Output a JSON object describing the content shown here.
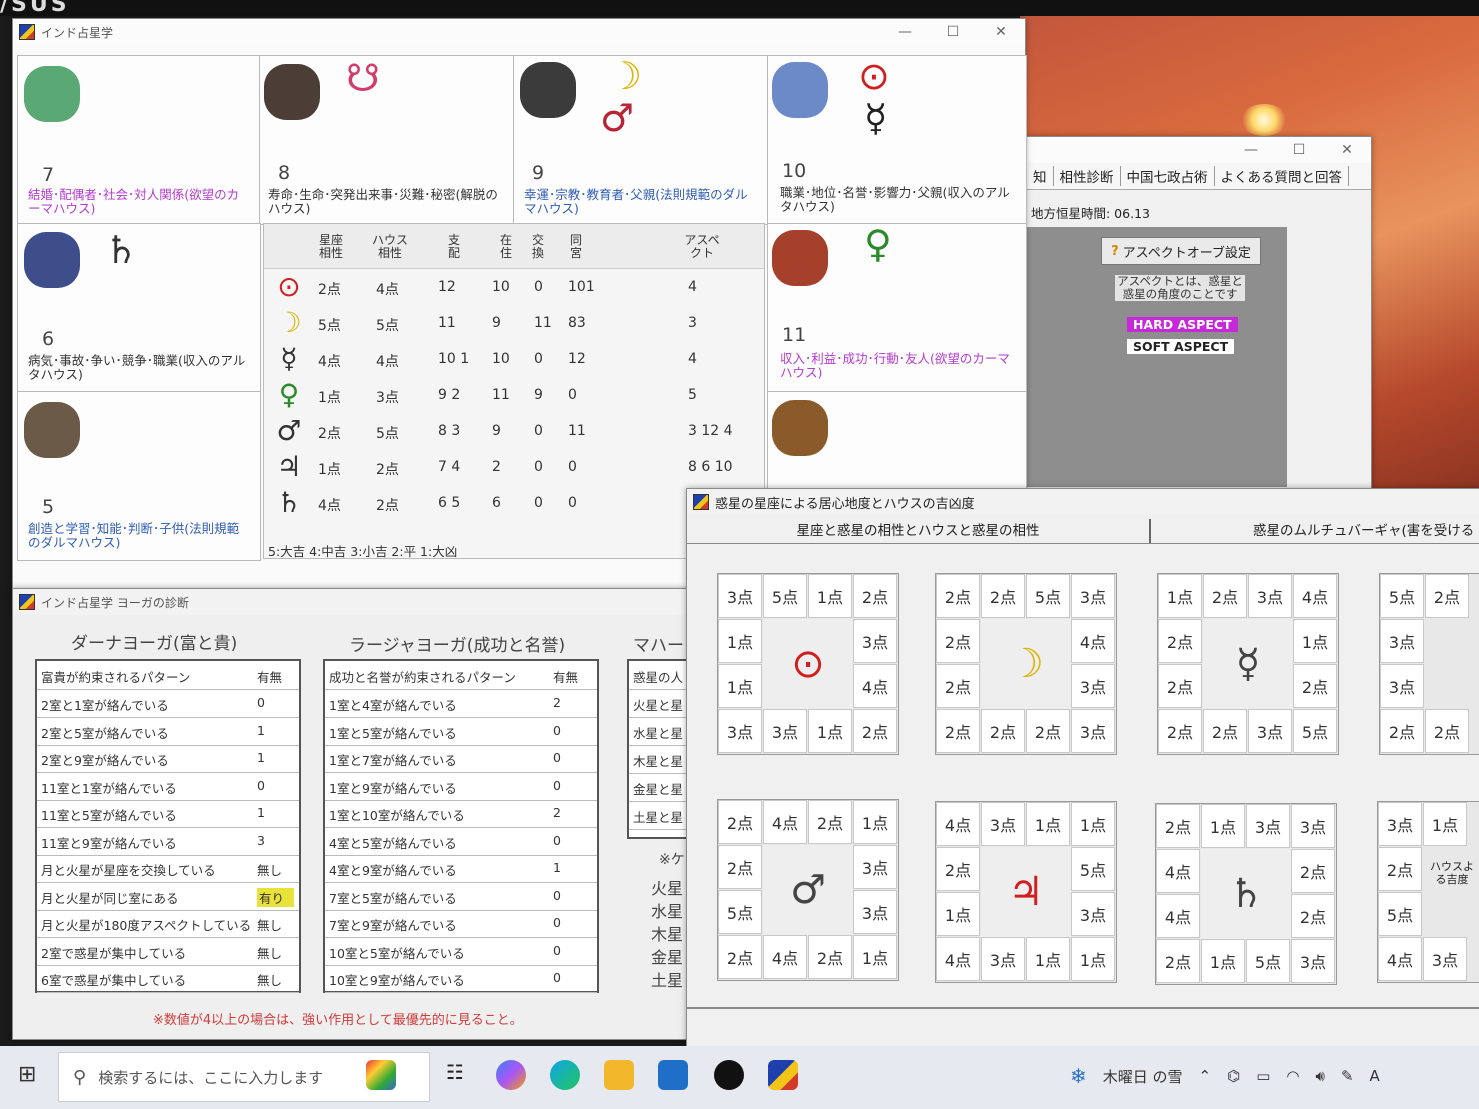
{
  "brand": "/SUS",
  "window_chart": {
    "title": "インド占星学",
    "houses": [
      {
        "num": "7",
        "desc": "結婚･配偶者･社会･対人関係(欲望のカーマハウス)"
      },
      {
        "num": "8",
        "desc": "寿命･生命･突発出来事･災難･秘密(解脱のハウス)"
      },
      {
        "num": "9",
        "desc": "幸運･宗教･教育者･父親(法則規範のダルマハウス)"
      },
      {
        "num": "10",
        "desc": "職業･地位･名誉･影響力･父親(収入のアルタハウス)"
      },
      {
        "num": "6",
        "desc": "病気･事故･争い･競争･職業(収入のアルタハウス)"
      },
      {
        "num": "11",
        "desc": "収入･利益･成功･行動･友人(欲望のカーマハウス)"
      },
      {
        "num": "5",
        "desc": "創造と学習･知能･判断･子供(法則規範のダルマハウス)"
      }
    ],
    "table_headers": [
      "星座相性",
      "ハウス相性",
      "支配",
      "在住",
      "交換",
      "同宮",
      "アスペクト"
    ],
    "rows": [
      {
        "sym": "⊙",
        "a": "2点",
        "b": "4点",
        "c": "12",
        "d": "10",
        "e": "0",
        "f": "101",
        "g": "4"
      },
      {
        "sym": "☽",
        "a": "5点",
        "b": "5点",
        "c": "11",
        "d": "9",
        "e": "11",
        "f": "83",
        "g": "3"
      },
      {
        "sym": "☿",
        "a": "4点",
        "b": "4点",
        "c": "10 1",
        "d": "10",
        "e": "0",
        "f": "12",
        "g": "4"
      },
      {
        "sym": "♀",
        "a": "1点",
        "b": "3点",
        "c": "9 2",
        "d": "11",
        "e": "9",
        "f": "0",
        "g": "5"
      },
      {
        "sym": "♂",
        "a": "2点",
        "b": "5点",
        "c": "8 3",
        "d": "9",
        "e": "0",
        "f": "11",
        "g": "3 12 4"
      },
      {
        "sym": "♃",
        "a": "1点",
        "b": "2点",
        "c": "7 4",
        "d": "2",
        "e": "0",
        "f": "0",
        "g": "8 6 10"
      },
      {
        "sym": "♄",
        "a": "4点",
        "b": "2点",
        "c": "6 5",
        "d": "6",
        "e": "0",
        "f": "0",
        "g": ""
      }
    ],
    "legend": "5:大吉 4:中吉 3:小吉 2:平 1:大凶"
  },
  "window_right": {
    "menu": [
      "知",
      "相性診断",
      "中国七政占術",
      "よくある質問と回答"
    ],
    "local_time": "地方恒星時間: 06.13",
    "aspect_button": "アスペクトオーブ設定",
    "aspect_note": "アスペクトとは、惑星と惑星の角度のことです",
    "hard": "HARD ASPECT",
    "soft": "SOFT ASPECT"
  },
  "window_yoga": {
    "title": "インド占星学 ヨーガの診断",
    "dhana_title": "ダーナヨーガ(富と貴)",
    "dhana_header": [
      "富貴が約束されるパターン",
      "有無"
    ],
    "dhana_rows": [
      {
        "p": "2室と1室が絡んでいる",
        "v": "0"
      },
      {
        "p": "2室と5室が絡んでいる",
        "v": "1"
      },
      {
        "p": "2室と9室が絡んでいる",
        "v": "1"
      },
      {
        "p": "11室と1室が絡んでいる",
        "v": "0"
      },
      {
        "p": "11室と5室が絡んでいる",
        "v": "1"
      },
      {
        "p": "11室と9室が絡んでいる",
        "v": "3"
      },
      {
        "p": "月と火星が星座を交換している",
        "v": "無し"
      },
      {
        "p": "月と火星が同じ室にある",
        "v": "有り"
      },
      {
        "p": "月と火星が180度アスペクトしている",
        "v": "無し"
      },
      {
        "p": "2室で惑星が集中している",
        "v": "無し"
      },
      {
        "p": "6室で惑星が集中している",
        "v": "無し"
      }
    ],
    "raja_title": "ラージャヨーガ(成功と名誉)",
    "raja_header": [
      "成功と名誉が約束されるパターン",
      "有無"
    ],
    "raja_rows": [
      {
        "p": "1室と4室が絡んでいる",
        "v": "2"
      },
      {
        "p": "1室と5室が絡んでいる",
        "v": "0"
      },
      {
        "p": "1室と7室が絡んでいる",
        "v": "0"
      },
      {
        "p": "1室と9室が絡んでいる",
        "v": "0"
      },
      {
        "p": "1室と10室が絡んでいる",
        "v": "2"
      },
      {
        "p": "4室と5室が絡んでいる",
        "v": "0"
      },
      {
        "p": "4室と9室が絡んでいる",
        "v": "1"
      },
      {
        "p": "7室と5室が絡んでいる",
        "v": "0"
      },
      {
        "p": "7室と9室が絡んでいる",
        "v": "0"
      },
      {
        "p": "10室と5室が絡んでいる",
        "v": "0"
      },
      {
        "p": "10室と9室が絡んでいる",
        "v": "0"
      }
    ],
    "maha_title": "マハー",
    "maha_rows": [
      "惑星の人",
      "火星と星",
      "水星と星",
      "木星と星",
      "金星と星",
      "土星と星"
    ],
    "maha_note": "※ケ",
    "maha_list": [
      "火星",
      "水星",
      "木星",
      "金星",
      "土星"
    ],
    "footer_note": "※数値が4以上の場合は、強い作用として最優先的に見ること。"
  },
  "window_dignity": {
    "title": "惑星の星座による居心地度とハウスの吉凶度",
    "tab1": "星座と惑星の相性とハウスと惑星の相性",
    "tab2": "惑星のムルチュバーギャ(害を受ける",
    "grids": [
      {
        "sym": "⊙",
        "color": "#d11f1f",
        "top": [
          "3点",
          "5点",
          "1点",
          "2点"
        ],
        "left": [
          "1点",
          "1点"
        ],
        "right": [
          "3点",
          "4点"
        ],
        "bottom": [
          "3点",
          "3点",
          "1点",
          "2点"
        ]
      },
      {
        "sym": "☽",
        "color": "#d9b400",
        "top": [
          "2点",
          "2点",
          "5点",
          "3点"
        ],
        "left": [
          "2点",
          "2点"
        ],
        "right": [
          "4点",
          "3点"
        ],
        "bottom": [
          "2点",
          "2点",
          "2点",
          "3点"
        ]
      },
      {
        "sym": "☿",
        "color": "#444",
        "top": [
          "1点",
          "2点",
          "3点",
          "4点"
        ],
        "left": [
          "2点",
          "2点"
        ],
        "right": [
          "1点",
          "2点"
        ],
        "bottom": [
          "2点",
          "2点",
          "3点",
          "5点"
        ]
      },
      {
        "sym": "♂",
        "color": "#444",
        "top": [
          "2点",
          "4点",
          "2点",
          "1点"
        ],
        "left": [
          "2点",
          "5点"
        ],
        "right": [
          "3点",
          "3点"
        ],
        "bottom": [
          "2点",
          "4点",
          "2点",
          "1点"
        ]
      },
      {
        "sym": "♃",
        "color": "#d11f1f",
        "top": [
          "4点",
          "3点",
          "1点",
          "1点"
        ],
        "left": [
          "2点",
          "1点"
        ],
        "right": [
          "5点",
          "3点"
        ],
        "bottom": [
          "4点",
          "3点",
          "1点",
          "1点"
        ]
      },
      {
        "sym": "♄",
        "color": "#444",
        "top": [
          "2点",
          "1点",
          "3点",
          "3点"
        ],
        "left": [
          "4点",
          "4点"
        ],
        "right": [
          "2点",
          "2点"
        ],
        "bottom": [
          "2点",
          "1点",
          "5点",
          "3点"
        ]
      }
    ],
    "partial_top": [
      "5点",
      "2点",
      "3点",
      "3点",
      "2点",
      "2点"
    ],
    "partial_bottom": [
      "3点",
      "1点",
      "2点",
      "5点",
      "4点",
      "3点"
    ],
    "partial_label": "ハウスよる吉度"
  },
  "taskbar": {
    "search_placeholder": "検索するには、ここに入力します",
    "weather": "木曜日 の雪"
  }
}
